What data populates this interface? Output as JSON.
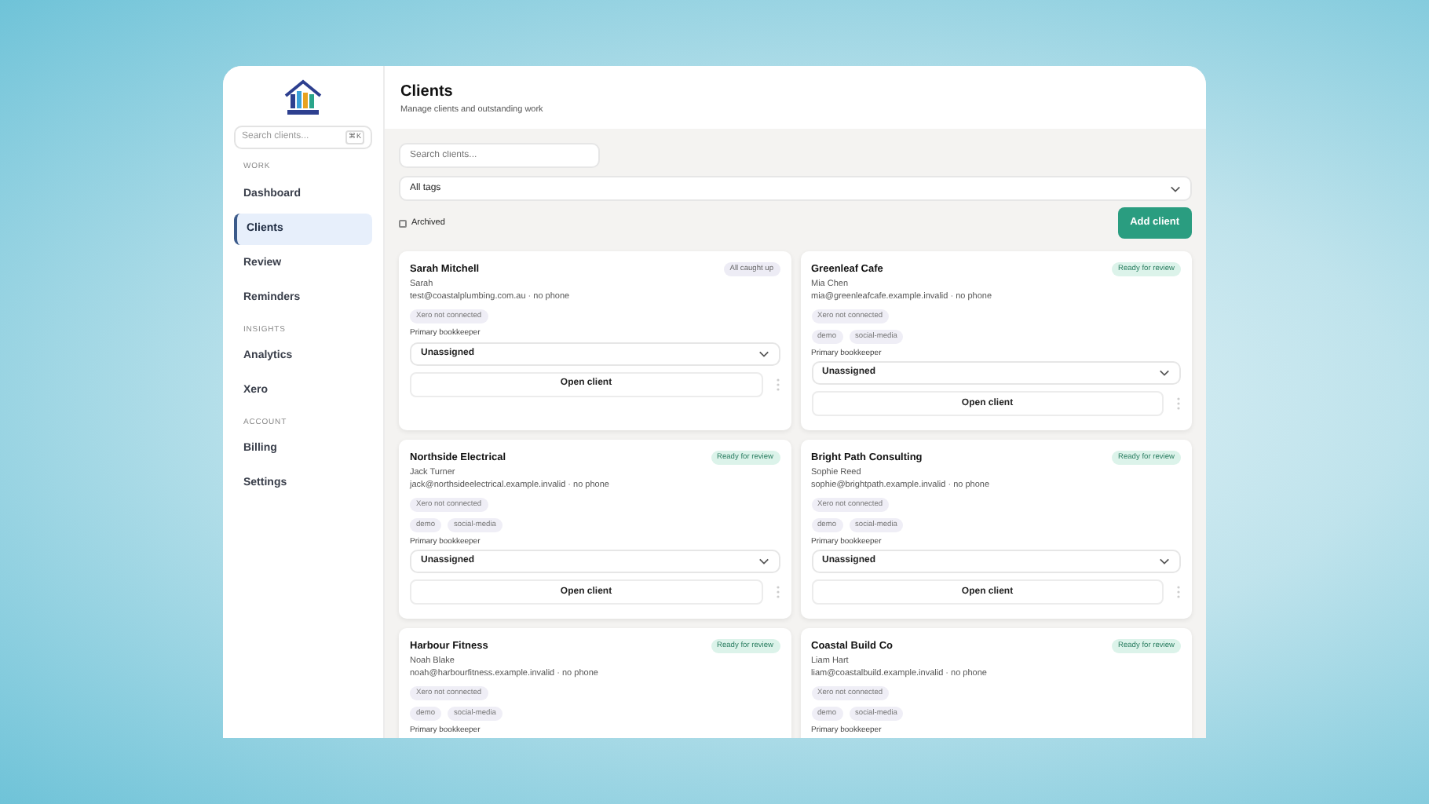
{
  "sidebar": {
    "search": {
      "placeholder": "Search clients...",
      "shortcut": "⌘K"
    },
    "sections": [
      {
        "heading": "WORK",
        "items": [
          {
            "label": "Dashboard",
            "selected": false
          },
          {
            "label": "Clients",
            "selected": true
          },
          {
            "label": "Review",
            "selected": false
          },
          {
            "label": "Reminders",
            "selected": false
          }
        ]
      },
      {
        "heading": "INSIGHTS",
        "items": [
          {
            "label": "Analytics",
            "selected": false
          },
          {
            "label": "Xero",
            "selected": false
          }
        ]
      },
      {
        "heading": "ACCOUNT",
        "items": [
          {
            "label": "Billing",
            "selected": false
          },
          {
            "label": "Settings",
            "selected": false
          }
        ]
      }
    ]
  },
  "header": {
    "title": "Clients",
    "subtitle": "Manage clients and outstanding work"
  },
  "toolbar": {
    "search": {
      "placeholder": "Search clients..."
    },
    "tag_filter": "All tags",
    "archived": {
      "label": "Archived",
      "checked": false
    },
    "add_button": "Add client"
  },
  "clients": [
    {
      "name": "Sarah Mitchell",
      "contact": "Sarah",
      "details": "test@coastalplumbing.com.au · no phone",
      "status": {
        "kind": "caught_up",
        "label": "All caught up"
      },
      "xero": "Xero not connected",
      "bookkeeper_label": "Primary bookkeeper",
      "bookkeeper": "Unassigned",
      "open_button": "Open client"
    },
    {
      "name": "Greenleaf Cafe",
      "contact": "Mia Chen",
      "details": "mia@greenleafcafe.example.invalid · no phone",
      "status": {
        "kind": "review",
        "label": "Ready for review"
      },
      "xero": "Xero not connected",
      "tags": [
        "demo",
        "social-media"
      ],
      "bookkeeper_label": "Primary bookkeeper",
      "bookkeeper": "Unassigned",
      "open_button": "Open client"
    },
    {
      "name": "Northside Electrical",
      "contact": "Jack Turner",
      "details": "jack@northsideelectrical.example.invalid · no phone",
      "status": {
        "kind": "review",
        "label": "Ready for review"
      },
      "xero": "Xero not connected",
      "tags": [
        "demo",
        "social-media"
      ],
      "bookkeeper_label": "Primary bookkeeper",
      "bookkeeper": "Unassigned",
      "open_button": "Open client"
    },
    {
      "name": "Bright Path Consulting",
      "contact": "Sophie Reed",
      "details": "sophie@brightpath.example.invalid · no phone",
      "status": {
        "kind": "review",
        "label": "Ready for review"
      },
      "xero": "Xero not connected",
      "tags": [
        "demo",
        "social-media"
      ],
      "bookkeeper_label": "Primary bookkeeper",
      "bookkeeper": "Unassigned",
      "open_button": "Open client"
    },
    {
      "name": "Harbour Fitness",
      "contact": "Noah Blake",
      "details": "noah@harbourfitness.example.invalid · no phone",
      "status": {
        "kind": "review",
        "label": "Ready for review"
      },
      "xero": "Xero not connected",
      "tags": [
        "demo",
        "social-media"
      ],
      "bookkeeper_label": "Primary bookkeeper"
    },
    {
      "name": "Coastal Build Co",
      "contact": "Liam Hart",
      "details": "liam@coastalbuild.example.invalid · no phone",
      "status": {
        "kind": "review",
        "label": "Ready for review"
      },
      "xero": "Xero not connected",
      "tags": [
        "demo",
        "social-media"
      ],
      "bookkeeper_label": "Primary bookkeeper"
    }
  ]
}
